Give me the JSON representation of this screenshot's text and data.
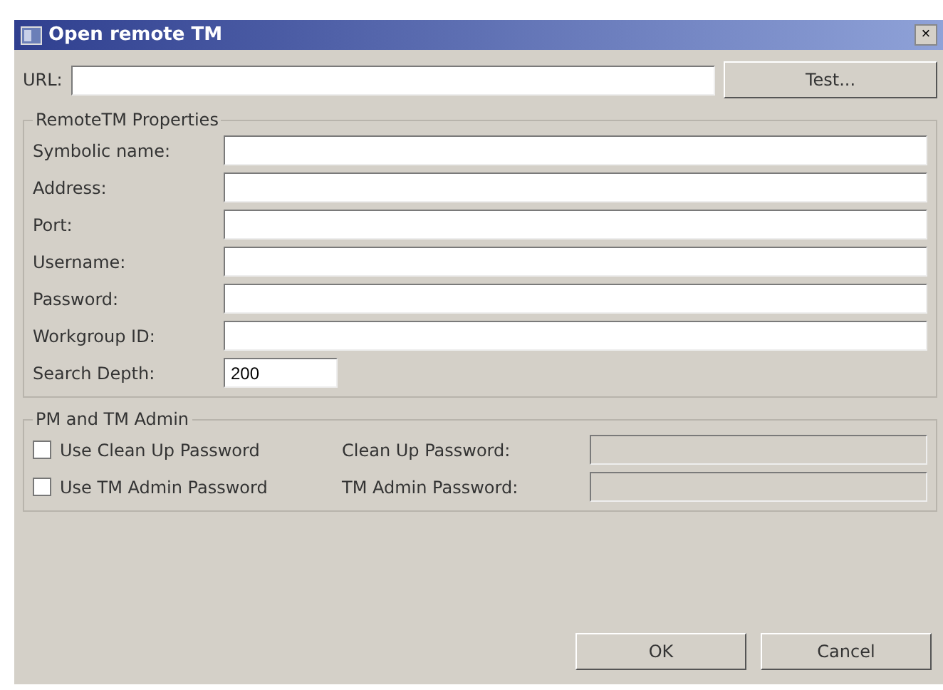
{
  "window": {
    "title": "Open remote TM",
    "close": "×"
  },
  "url": {
    "label": "URL:"
  },
  "test_button": "Test...",
  "properties": {
    "title": "RemoteTM Properties",
    "fields": [
      {
        "label": "Symbolic name:"
      },
      {
        "label": "Address:"
      },
      {
        "label": "Port:"
      },
      {
        "label": "Username:"
      },
      {
        "label": "Password:"
      },
      {
        "label": "Workgroup ID:"
      }
    ],
    "search_depth": {
      "label": "Search Depth:",
      "value": "200"
    }
  },
  "admin": {
    "title": "PM and TM Admin",
    "rows": [
      {
        "checkbox": "Use Clean Up Password",
        "checked": false,
        "label": "Clean Up Password:",
        "disabled": true
      },
      {
        "checkbox": "Use TM Admin Password",
        "checked": false,
        "label": "TM Admin Password:",
        "disabled": true
      }
    ]
  },
  "buttons": [
    "OK",
    "Cancel"
  ]
}
